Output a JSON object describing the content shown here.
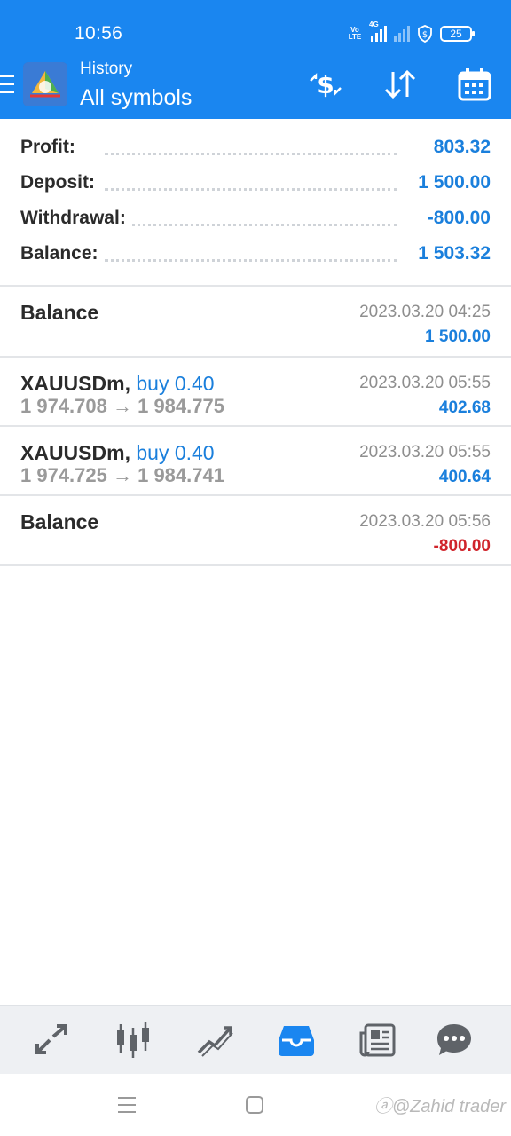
{
  "status": {
    "time": "10:56",
    "volte": "Vo LTE",
    "network": "4G",
    "battery": "25"
  },
  "header": {
    "subtitle": "History",
    "title": "All symbols"
  },
  "summary": [
    {
      "label": "Profit:",
      "value": "803.32"
    },
    {
      "label": "Deposit:",
      "value": "1 500.00"
    },
    {
      "label": "Withdrawal:",
      "value": "-800.00"
    },
    {
      "label": "Balance:",
      "value": "1 503.32"
    }
  ],
  "deals": [
    {
      "name": "Balance",
      "side": "",
      "prices": "",
      "time": "2023.03.20 04:25",
      "amount": "1 500.00",
      "amount_color": "#1a7fdc"
    },
    {
      "name": "XAUUSDm,",
      "side": "buy 0.40",
      "prices": "1 974.708 → 1 984.775",
      "time": "2023.03.20 05:55",
      "amount": "402.68",
      "amount_color": "#1a7fdc"
    },
    {
      "name": "XAUUSDm,",
      "side": "buy 0.40",
      "prices": "1 974.725 → 1 984.741",
      "time": "2023.03.20 05:55",
      "amount": "400.64",
      "amount_color": "#1a7fdc"
    },
    {
      "name": "Balance",
      "side": "",
      "prices": "",
      "time": "2023.03.20 05:56",
      "amount": "-800.00",
      "amount_color": "#d0242b"
    }
  ],
  "bottom_nav": [
    "quotes-icon",
    "chart-icon",
    "trade-icon",
    "history-icon",
    "news-icon",
    "chat-icon"
  ],
  "active_nav": "history-icon",
  "watermark": "ⓐ@Zahid trader",
  "colors": {
    "primary": "#1a86f0",
    "positive": "#1a7fdc",
    "negative": "#d0242b"
  }
}
